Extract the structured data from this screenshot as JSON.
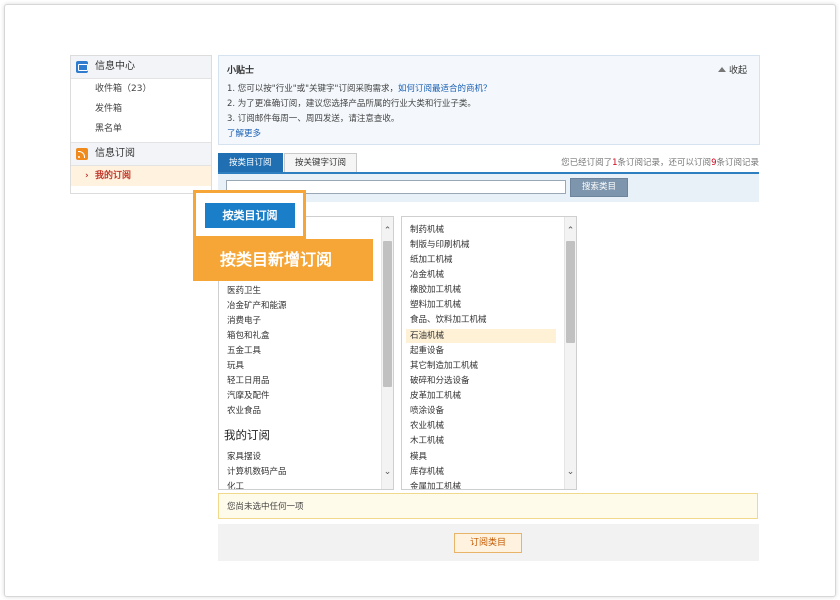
{
  "sidebar": {
    "sections": [
      {
        "title": "信息中心",
        "icon": "mail-icon",
        "items": [
          "收件箱（23）",
          "发件箱",
          "黑名单"
        ]
      },
      {
        "title": "信息订阅",
        "icon": "rss-icon",
        "items": [
          "我的订阅"
        ]
      }
    ],
    "active_item": "我的订阅"
  },
  "tips": {
    "title": "小贴士",
    "collapse_label": "收起",
    "line1_text": "1. 您可以按\"行业\"或\"关键字\"订阅采购需求，",
    "line1_link": "如何订阅最适合的商机？",
    "line2": "2. 为了更准确订阅，建议您选择产品所属的行业大类和行业子类。",
    "line3": "3. 订阅邮件每周一、周四发送，请注意查收。",
    "more_link": "了解更多"
  },
  "tabs": {
    "items": [
      "按类目订阅",
      "按关键字订阅"
    ],
    "active": "按类目订阅",
    "note_a": "您已经订阅了",
    "note_count": "1",
    "note_b": "条订阅记录，还可以订阅",
    "note_remaining": "9",
    "note_c": "条订阅记录"
  },
  "search": {
    "input_value": "",
    "button_label": "搜索类目"
  },
  "left_list": {
    "items": [
      "医药卫生",
      "冶金矿产和能源",
      "消费电子",
      "箱包和礼盒",
      "五金工具",
      "玩具",
      "轻工日用品",
      "汽摩及配件",
      "农业食品",
      "家具摆设",
      "计算机数码产品",
      "化工"
    ]
  },
  "right_list": {
    "items": [
      "制药机械",
      "制版与印刷机械",
      "纸加工机械",
      "冶金机械",
      "橡胶加工机械",
      "塑料加工机械",
      "食品、饮料加工机械",
      "石油机械",
      "起重设备",
      "其它制造加工机械",
      "破碎和分选设备",
      "皮革加工机械",
      "喷涂设备",
      "农业机械",
      "木工机械",
      "模具",
      "库存机械",
      "金属加工机械"
    ],
    "selected": "石油机械"
  },
  "callout": {
    "tab_label": "按类目订阅",
    "banner_text": "按类目新增订阅",
    "floating_label": "我的订阅"
  },
  "status_text": "您尚未选中任何一项",
  "footer": {
    "button_label": "订阅类目"
  },
  "colors": {
    "accent_blue": "#1f6fb2",
    "callout_orange": "#f5a637",
    "selected_row": "#fff1d6",
    "highlight_red": "#d0021b"
  }
}
